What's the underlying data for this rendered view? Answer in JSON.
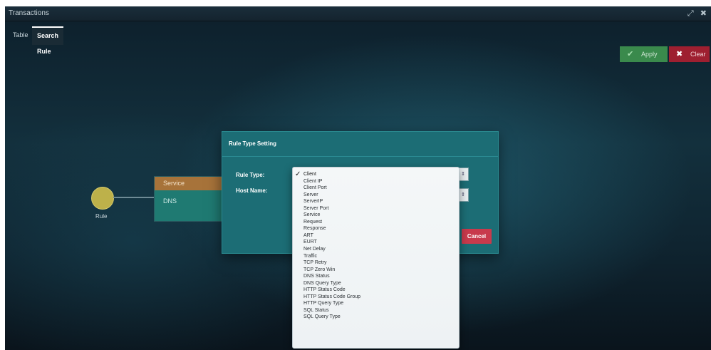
{
  "window": {
    "title": "Transactions",
    "expand_icon": "⤢",
    "close_icon": "✖"
  },
  "tabs": [
    {
      "label": "Table"
    },
    {
      "label": "Search Rule",
      "active": true
    }
  ],
  "toolbar": {
    "apply": {
      "label": "Apply",
      "icon": "check-icon"
    },
    "clear": {
      "label": "Clear",
      "icon": "x-icon"
    }
  },
  "diagram": {
    "rule_node_label": "Rule",
    "service_header": "Service",
    "service_value": "DNS"
  },
  "modal": {
    "title": "Rule Type Setting",
    "rule_type_label": "Rule Type:",
    "host_name_label": "Host Name:",
    "cancel_label": "Cancel"
  },
  "dropdown": {
    "selected": "Client",
    "options": [
      "Client",
      "Client IP",
      "Client Port",
      "Server",
      "ServerIP",
      "Server Port",
      "Service",
      "Request",
      "Response",
      "ART",
      "EURT",
      "Net Delay",
      "Traffic",
      "TCP Retry",
      "TCP Zero Win",
      "DNS Status",
      "DNS Query Type",
      "HTTP Status Code",
      "HTTP Status Code Group",
      "HTTP Query Type",
      "SQL Status",
      "SQL Query Type"
    ]
  },
  "colors": {
    "apply_bg": "#3a8a4c",
    "clear_bg": "#9e1f30",
    "cancel_bg": "#c83a4c",
    "modal_bg": "#1c6d75",
    "service_header_bg": "#a7733a",
    "service_body_bg": "#1f7a72",
    "rule_node": "#bdb14a"
  }
}
